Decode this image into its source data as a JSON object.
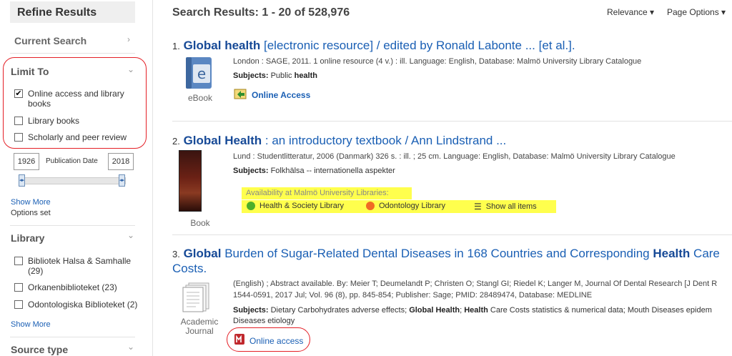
{
  "sidebar": {
    "header": "Refine Results",
    "current_search": "Current Search",
    "limit_to": "Limit To",
    "limits": [
      {
        "label": "Online access and library books",
        "checked": true
      },
      {
        "label": "Library books",
        "checked": false
      },
      {
        "label": "Scholarly and peer review",
        "checked": false
      }
    ],
    "publication_date": {
      "label": "Publication Date",
      "from": "1926",
      "to": "2018"
    },
    "show_more_1": "Show More",
    "options_set": "Options set",
    "library_title": "Library",
    "libraries": [
      {
        "label": "Bibliotek Halsa & Samhalle (29)"
      },
      {
        "label": "Orkanenbiblioteket (23)"
      },
      {
        "label": "Odontologiska Biblioteket (2)"
      }
    ],
    "show_more_2": "Show More",
    "source_type": "Source type"
  },
  "main": {
    "title": "Search Results: 1 - 20 of 528,976",
    "sort": "Relevance",
    "page_options": "Page Options",
    "results": [
      {
        "num": "1.",
        "title_bold": "Global health",
        "title_rest": " [electronic resource] / edited by Ronald Labonte ... [et al.].",
        "meta": "London : SAGE, 2011. 1 online resource (4 v.) : ill. Language: English, Database: Malmö University Library Catalogue",
        "subjects_label": "Subjects:",
        "subjects_pre": " Public ",
        "subjects_bold": "health",
        "type": "eBook",
        "access": "Online Access"
      },
      {
        "num": "2.",
        "title_bold": "Global Health",
        "title_rest": " : an introductory textbook / Ann Lindstrand ...",
        "meta": "Lund : Studentlitteratur, 2006 (Danmark) 326 s. : ill. ; 25 cm. Language: English, Database: Malmö University Library Catalogue",
        "subjects_label": "Subjects:",
        "subjects_text": " Folkhälsa -- internationella aspekter",
        "type": "Book",
        "availability": "Availability at Malmö University Libraries:",
        "lib1": "Health & Society Library",
        "lib2": "Odontology Library",
        "show_all": "Show all items"
      },
      {
        "num": "3.",
        "title_bold1": "Global",
        "title_mid": " Burden of Sugar-Related Dental Diseases in 168 Countries and Corresponding ",
        "title_bold2": "Health",
        "title_end": " Care",
        "title_line2": "Costs.",
        "meta1": "(English) ; Abstract available. By: Meier T; Deumelandt P; Christen O; Stangl GI; Riedel K; Langer M, Journal Of Dental Research [J Dent R",
        "meta2": "1544-0591, 2017 Jul; Vol. 96 (8), pp. 845-854; Publisher: Sage; PMID: 28489474, Database: MEDLINE",
        "subjects_label": "Subjects:",
        "subjects_a": " Dietary Carbohydrates adverse effects; ",
        "subjects_b": "Global Health",
        "subjects_c": "; ",
        "subjects_d": "Health",
        "subjects_e": " Care Costs statistics & numerical data; Mouth Diseases epidem",
        "subjects_line2": "Diseases etiology",
        "type_line1": "Academic",
        "type_line2": "Journal",
        "access": "Online access"
      }
    ]
  },
  "colors": {
    "link": "#1a5fb4",
    "annotation": "#e41f26",
    "highlight": "#ffff4d",
    "dot_green": "#4caf2a",
    "dot_orange": "#f06a24"
  }
}
